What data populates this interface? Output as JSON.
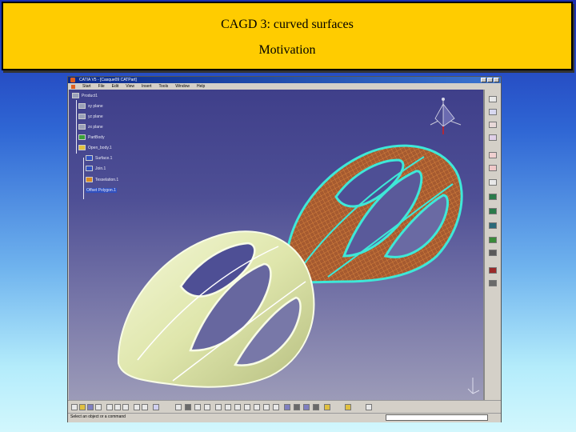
{
  "slide": {
    "title": "CAGD 3:  curved surfaces",
    "subtitle": "Motivation",
    "title_bg": "#ffcc00"
  },
  "window": {
    "title": "CATIA V5 - [Casque09 CATPart]",
    "menu": [
      "Start",
      "File",
      "Edit",
      "View",
      "Insert",
      "Tools",
      "Window",
      "Help"
    ]
  },
  "tree": {
    "root": "Product1",
    "items": [
      "xy plane",
      "yz plane",
      "zx plane",
      "PartBody",
      "Open_body.1",
      "Surface.1",
      "Join.1",
      "Tesselation.1",
      "Offset Polygon.1"
    ]
  },
  "status": {
    "prompt": "Select an object or a command"
  },
  "colors": {
    "wire_cyan": "#3ee8d8",
    "wire_orange": "#c8602a",
    "solid_yellow": "#e4ecb4"
  }
}
